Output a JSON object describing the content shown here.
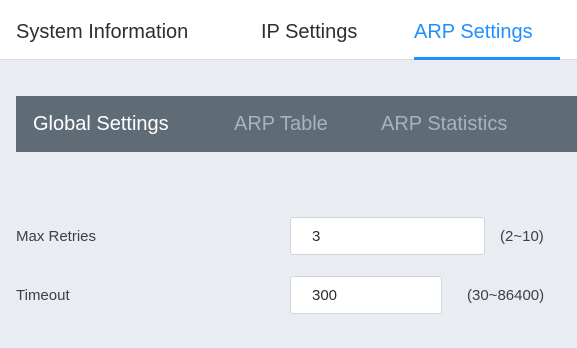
{
  "top_tabs": [
    {
      "label": "System Information",
      "active": false
    },
    {
      "label": "IP Settings",
      "active": false
    },
    {
      "label": "ARP Settings",
      "active": true
    }
  ],
  "sub_tabs": [
    {
      "label": "Global Settings",
      "active": true
    },
    {
      "label": "ARP Table",
      "active": false
    },
    {
      "label": "ARP Statistics",
      "active": false
    }
  ],
  "fields": {
    "max_retries": {
      "label": "Max Retries",
      "value": "3",
      "range": "(2~10)"
    },
    "timeout": {
      "label": "Timeout",
      "value": "300",
      "range": "(30~86400)"
    }
  },
  "colors": {
    "accent": "#1e90ff",
    "subnav_bg": "#5f6b75",
    "page_bg": "#e9edf1"
  }
}
